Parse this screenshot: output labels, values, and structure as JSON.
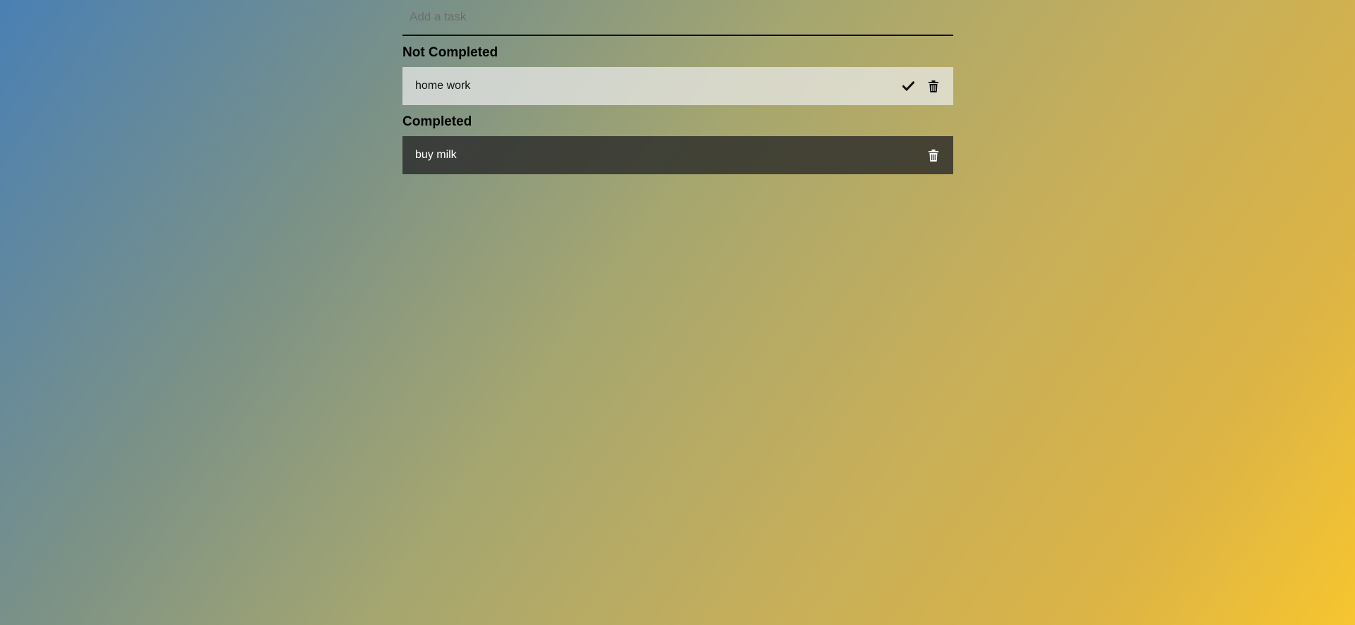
{
  "input": {
    "placeholder": "Add a task",
    "value": ""
  },
  "sections": {
    "not_completed": {
      "heading": "Not Completed",
      "tasks": [
        {
          "text": "home work",
          "actions": [
            "check-icon",
            "trash-icon"
          ]
        }
      ]
    },
    "completed": {
      "heading": "Completed",
      "tasks": [
        {
          "text": "buy milk",
          "actions": [
            "trash-icon"
          ]
        }
      ]
    }
  },
  "colors": {
    "gradient_start": "#4a80b4",
    "gradient_end": "#f7c52f",
    "not_completed_bg": "#d5d2bd",
    "completed_bg": "#434538"
  }
}
